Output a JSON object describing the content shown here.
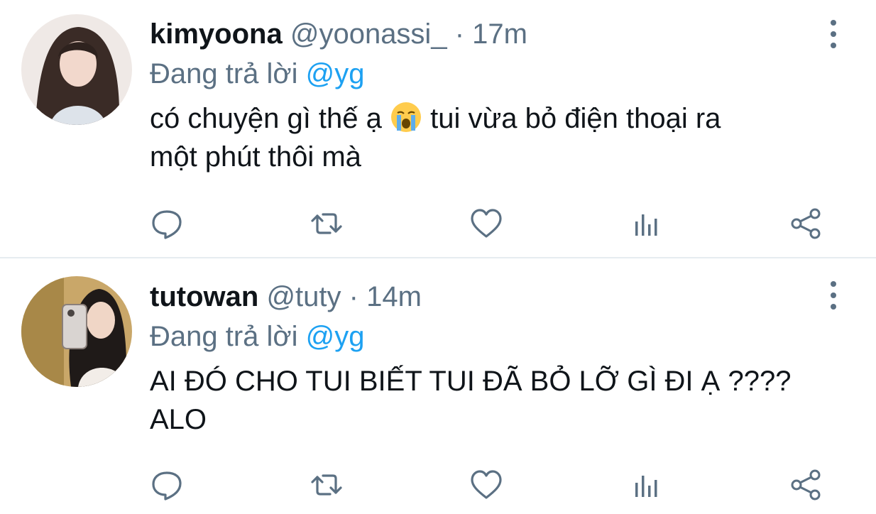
{
  "tweets": [
    {
      "display_name": "kimyoona",
      "handle": "@yoonassi_",
      "separator": "·",
      "time": "17m",
      "reply_prefix": "Đang trả lời",
      "reply_target": "@yg",
      "text_before_emoji": "có chuyện gì thế ạ ",
      "emoji_name": "loudly-crying-face",
      "text_after_emoji": " tui vừa bỏ điện thoại ra\nmột phút thôi mà"
    },
    {
      "display_name": "tutowan",
      "handle": "@tuty",
      "separator": "·",
      "time": "14m",
      "reply_prefix": "Đang trả lời",
      "reply_target": "@yg",
      "text": "AI ĐÓ CHO TUI BIẾT TUI ĐÃ BỎ LỠ GÌ ĐI Ạ ????\nALO"
    }
  ],
  "icons": {
    "reply": "speech-bubble-icon",
    "retweet": "retweet-icon",
    "like": "heart-icon",
    "views": "bar-chart-icon",
    "share": "share-icon",
    "more": "vertical-ellipsis-icon"
  },
  "colors": {
    "text": "#0f1419",
    "secondary": "#5b7083",
    "link": "#1da1f2",
    "divider": "#e6ecf0",
    "icon": "#5b7083"
  }
}
